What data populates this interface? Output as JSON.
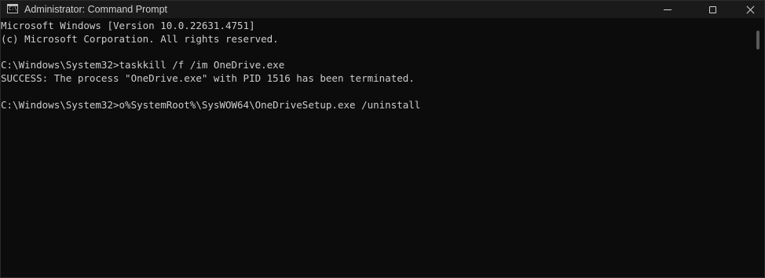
{
  "window": {
    "title": "Administrator: Command Prompt",
    "icon": "cmd-icon",
    "prompt_glyph": "C:\\",
    "controls": [
      "minimize-icon",
      "maximize-icon",
      "close-icon"
    ]
  },
  "console": {
    "lines": [
      "Microsoft Windows [Version 10.0.22631.4751]",
      "(c) Microsoft Corporation. All rights reserved.",
      "",
      "C:\\Windows\\System32>taskkill /f /im OneDrive.exe",
      "SUCCESS: The process \"OneDrive.exe\" with PID 1516 has been terminated.",
      "",
      "C:\\Windows\\System32>o%SystemRoot%\\SysWOW64\\OneDriveSetup.exe /uninstall"
    ]
  },
  "colors": {
    "background": "#0c0c0c",
    "titlebar": "#1a1a1a",
    "text": "#cccccc"
  }
}
